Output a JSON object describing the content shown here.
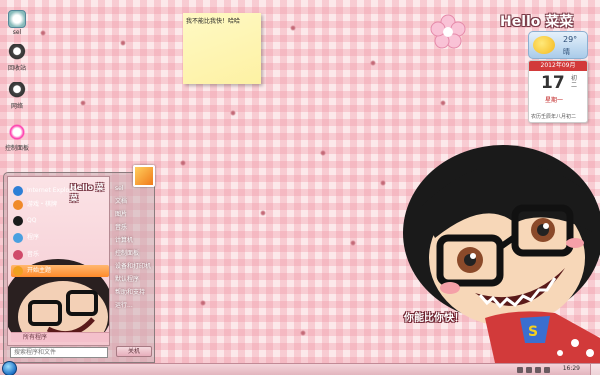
{
  "desktop": {
    "icons": [
      {
        "label": "sel",
        "name": "computer-icon"
      },
      {
        "label": "回收站",
        "name": "recycle-bin-icon"
      },
      {
        "label": "网络",
        "name": "network-icon"
      },
      {
        "label": "控制面板",
        "name": "control-panel-icon"
      }
    ],
    "sticky_note": "我不能比我快！哈哈"
  },
  "widgets": {
    "hello_title": "Hello 菜菜",
    "weather": {
      "temp": "29°",
      "condition": "晴"
    },
    "calendar": {
      "month_label": "2012年09月",
      "day": "17",
      "weekday": "星期一",
      "lunar_side": "初二",
      "lunar": "农历壬辰年八月初二"
    },
    "catchphrase": "你能比你快！"
  },
  "start_menu": {
    "hello_label": "Hello 菜菜",
    "programs": [
      {
        "label": "Internet Explorer",
        "color": "#2e7fd6"
      },
      {
        "label": "游戏・棋牌",
        "color": "#f08a2a"
      },
      {
        "label": "QQ",
        "color": "#1b1b1b"
      },
      {
        "label": "程序",
        "color": "#4aa0e0"
      },
      {
        "label": "音乐",
        "color": "#d04a6a"
      },
      {
        "label": "开始主题",
        "color": "#f0a020"
      }
    ],
    "all_programs": "所有程序",
    "search_placeholder": "搜索程序和文件",
    "right_items": [
      "sel",
      "文档",
      "图片",
      "音乐",
      "计算机",
      "控制面板",
      "设备和打印机",
      "默认程序",
      "帮助和支持",
      "运行..."
    ],
    "shutdown": "关机"
  },
  "taskbar": {
    "clock": "16:29"
  },
  "colors": {
    "accent": "#f08a2a",
    "background": "#fce8ea",
    "grid": "#f096a5"
  }
}
